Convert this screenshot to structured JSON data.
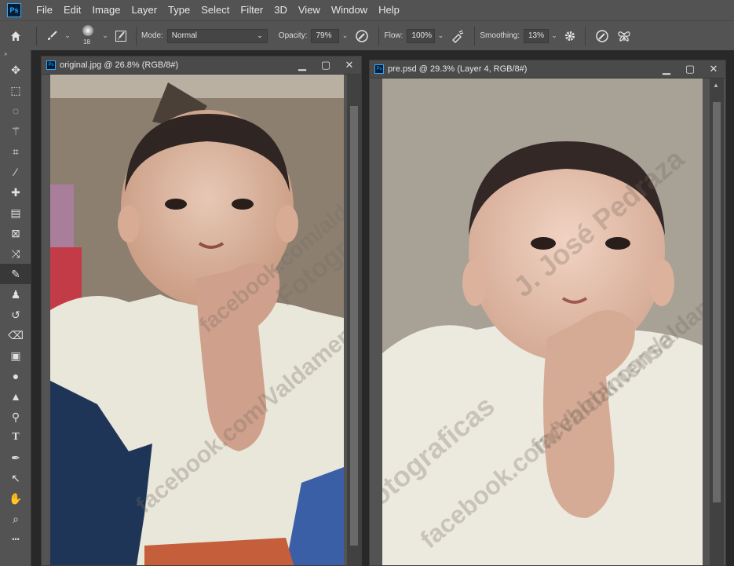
{
  "app": {
    "logo": "Ps"
  },
  "menu": [
    "File",
    "Edit",
    "Image",
    "Layer",
    "Type",
    "Select",
    "Filter",
    "3D",
    "View",
    "Window",
    "Help"
  ],
  "options": {
    "brush_size": "18",
    "mode_label": "Mode:",
    "mode_value": "Normal",
    "opacity_label": "Opacity:",
    "opacity_value": "79%",
    "flow_label": "Flow:",
    "flow_value": "100%",
    "smoothing_label": "Smoothing:",
    "smoothing_value": "13%"
  },
  "tools": [
    "move-tool",
    "marquee-tool",
    "lasso-tool",
    "magic-wand-tool",
    "crop-tool",
    "eyedropper-tool",
    "healing-brush-tool",
    "patch-tool",
    "frame-tool",
    "content-aware-move-tool",
    "brush-tool",
    "clone-stamp-tool",
    "history-brush-tool",
    "eraser-tool",
    "gradient-tool",
    "blur-tool",
    "sharpen-tool",
    "dodge-tool",
    "type-tool",
    "pen-tool",
    "path-selection-tool",
    "hand-tool",
    "zoom-tool",
    "more-tools"
  ],
  "documents": [
    {
      "title": "original.jpg @ 26.8% (RGB/8#)",
      "ps": "Ps"
    },
    {
      "title": "pre.psd @ 29.3% (Layer 4, RGB/8#)",
      "ps": "Ps"
    }
  ],
  "watermark": {
    "lines": [
      "J. José Pedraza",
      "facebook.com/Valdamense",
      "Fotograficas",
      "facebook.com/aldamense"
    ]
  },
  "colors": {
    "ui_bg": "#535353",
    "dark": "#282828",
    "accent": "#31a8ff"
  }
}
